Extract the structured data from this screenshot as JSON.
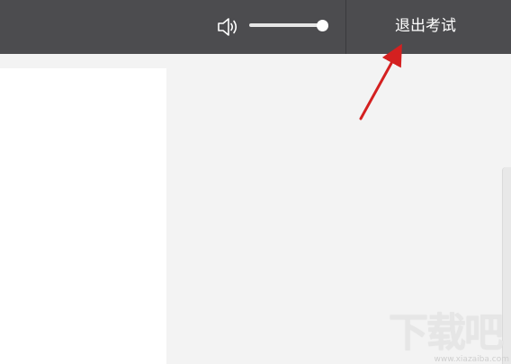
{
  "topbar": {
    "exit_label": "退出考试",
    "volume": {
      "icon": "speaker-icon",
      "level": 1.0
    }
  },
  "colors": {
    "topbar_bg": "#4c4c4f",
    "content_bg": "#f3f3f3",
    "annotation_arrow": "#d42020"
  },
  "watermark": {
    "logo": "下载吧",
    "url": "www.xiazaiba.com"
  }
}
